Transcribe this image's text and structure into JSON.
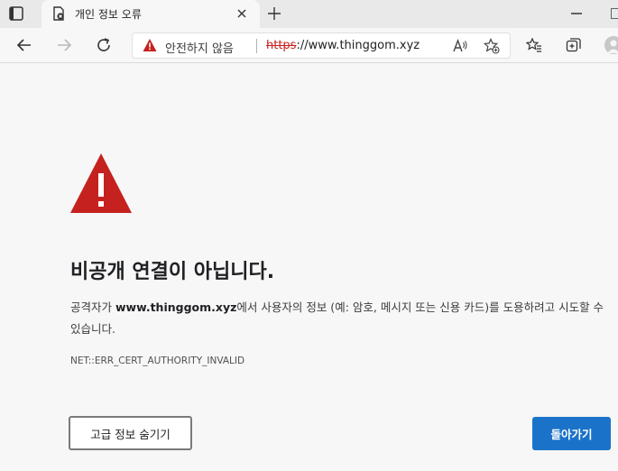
{
  "tab": {
    "title": "개인 정보 오류"
  },
  "toolbar": {
    "security_label": "안전하지 않음",
    "url_scheme": "https",
    "url_rest": "://www.thinggom.xyz"
  },
  "page": {
    "heading": "비공개 연결이 아닙니다.",
    "para_prefix": "공격자가 ",
    "para_domain": "www.thinggom.xyz",
    "para_suffix": "에서 사용자의 정보 (예: 암호, 메시지 또는 신용 카드)를 도용하려고 시도할 수 있습니다.",
    "error_code": "NET::ERR_CERT_AUTHORITY_INVALID",
    "advanced_button": "고급 정보 숨기기",
    "back_button": "돌아가기"
  },
  "colors": {
    "warning_red": "#c5221f",
    "primary_blue": "#1b73c9"
  }
}
